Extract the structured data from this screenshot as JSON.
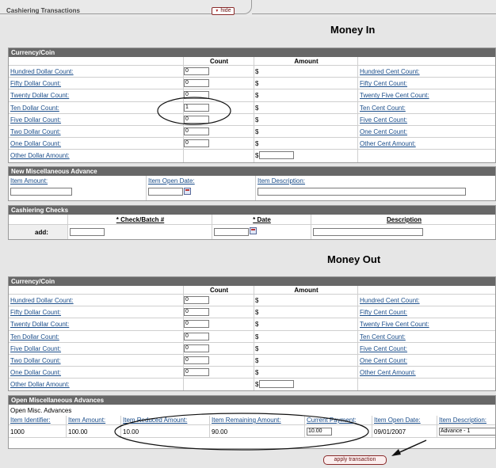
{
  "tab": {
    "title": "Cashiering Transactions",
    "hide_label": "hide"
  },
  "money_in": {
    "heading": "Money In",
    "currency": {
      "section_title": "Currency/Coin",
      "count_header": "Count",
      "amount_header": "Amount",
      "currency_symbol": "$",
      "rows": [
        {
          "label": "Hundred Dollar Count:",
          "count": "0",
          "cent_label": "Hundred Cent Count:"
        },
        {
          "label": "Fifty Dollar Count:",
          "count": "0",
          "cent_label": "Fifty Cent Count:"
        },
        {
          "label": "Twenty Dollar Count:",
          "count": "0",
          "cent_label": "Twenty Five Cent Count:"
        },
        {
          "label": "Ten Dollar Count:",
          "count": "1",
          "cent_label": "Ten Cent Count:"
        },
        {
          "label": "Five Dollar Count:",
          "count": "0",
          "cent_label": "Five Cent Count:"
        },
        {
          "label": "Two Dollar Count:",
          "count": "0",
          "cent_label": "One Cent Count:"
        },
        {
          "label": "One Dollar Count:",
          "count": "0",
          "cent_label": "Other Cent Amount:"
        }
      ],
      "other_label": "Other Dollar Amount:"
    },
    "new_misc": {
      "section_title": "New Miscellaneous Advance",
      "item_amount_label": "Item Amount:",
      "item_open_date_label": "Item Open Date:",
      "item_description_label": "Item Description:"
    },
    "checks": {
      "section_title": "Cashiering Checks",
      "col_check": "* Check/Batch #",
      "col_date": "* Date",
      "col_description": "Description",
      "add_label": "add:"
    }
  },
  "money_out": {
    "heading": "Money Out",
    "currency": {
      "section_title": "Currency/Coin",
      "count_header": "Count",
      "amount_header": "Amount",
      "currency_symbol": "$",
      "rows": [
        {
          "label": "Hundred Dollar Count:",
          "count": "0",
          "cent_label": "Hundred Cent Count:"
        },
        {
          "label": "Fifty Dollar Count:",
          "count": "0",
          "cent_label": "Fifty Cent Count:"
        },
        {
          "label": "Twenty Dollar Count:",
          "count": "0",
          "cent_label": "Twenty Five Cent Count:"
        },
        {
          "label": "Ten Dollar Count:",
          "count": "0",
          "cent_label": "Ten Cent Count:"
        },
        {
          "label": "Five Dollar Count:",
          "count": "0",
          "cent_label": "Five Cent Count:"
        },
        {
          "label": "Two Dollar Count:",
          "count": "0",
          "cent_label": "One Cent Count:"
        },
        {
          "label": "One Dollar Count:",
          "count": "0",
          "cent_label": "Other Cent Amount:"
        }
      ],
      "other_label": "Other Dollar Amount:"
    },
    "open_misc": {
      "section_title": "Open Miscellaneous Advances",
      "subtitle": "Open Misc. Advances",
      "headers": [
        "Item Identifier:",
        "Item Amount:",
        "Item Reduced Amount:",
        "Item Remaining Amount:",
        "Current Payment:",
        "Item Open Date:",
        "Item Description:"
      ],
      "row": {
        "identifier": "1000",
        "amount": "100.00",
        "reduced": "10.00",
        "remaining": "90.00",
        "payment": "10.00",
        "open_date": "09/01/2007",
        "description": "Advance - 1"
      }
    }
  },
  "apply_label": "apply transaction",
  "colors": {
    "section_header": "#676767",
    "link": "#1a4d8a",
    "button_border": "#8a2a2a"
  }
}
